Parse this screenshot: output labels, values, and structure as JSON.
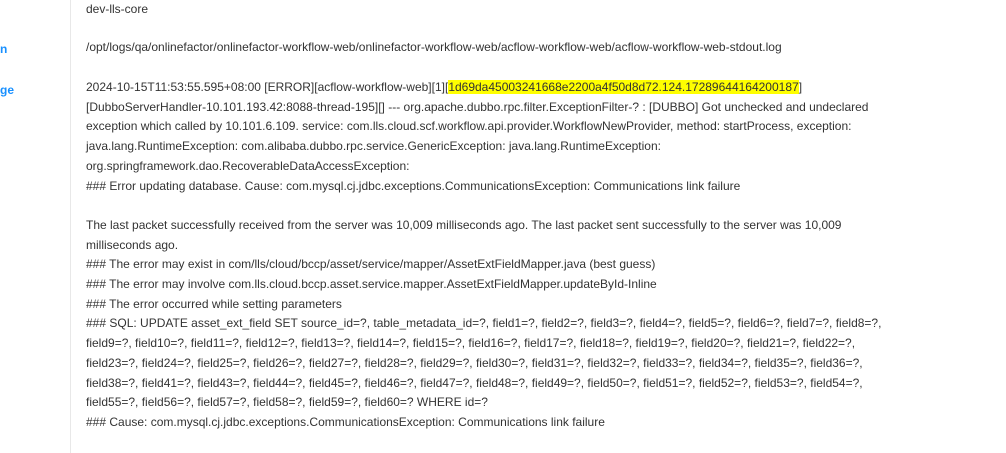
{
  "side_labels": {
    "label_1": "n",
    "label_2": "ge"
  },
  "project": "dev-lls-core",
  "log_path": "/opt/logs/qa/onlinefactor/onlinefactor-workflow-web/onlinefactor-workflow-web/acflow-workflow-web/acflow-workflow-web-stdout.log",
  "message": {
    "prefix": "2024-10-15T11:53:55.595+08:00 [ERROR][acflow-workflow-web][1][",
    "trace_id": "1d69da45003241668e2200a4f50d8d72.124.17289644164200187",
    "suffix": "]",
    "lines": [
      "[DubboServerHandler-10.101.193.42:8088-thread-195][] --- org.apache.dubbo.rpc.filter.ExceptionFilter-? :  [DUBBO] Got unchecked and undeclared",
      "exception which called by 10.101.6.109. service: com.lls.cloud.scf.workflow.api.provider.WorkflowNewProvider, method: startProcess, exception:",
      "java.lang.RuntimeException: com.alibaba.dubbo.rpc.service.GenericException: java.lang.RuntimeException:",
      "org.springframework.dao.RecoverableDataAccessException:",
      "### Error updating database.  Cause: com.mysql.cj.jdbc.exceptions.CommunicationsException: Communications link failure",
      "",
      "The last packet successfully received from the server was 10,009 milliseconds ago. The last packet sent successfully to the server was 10,009",
      "milliseconds ago.",
      "### The error may exist in com/lls/cloud/bccp/asset/service/mapper/AssetExtFieldMapper.java (best guess)",
      "### The error may involve com.lls.cloud.bccp.asset.service.mapper.AssetExtFieldMapper.updateById-Inline",
      "### The error occurred while setting parameters",
      "### SQL: UPDATE asset_ext_field  SET source_id=?, table_metadata_id=?, field1=?, field2=?, field3=?, field4=?, field5=?, field6=?, field7=?, field8=?,",
      "field9=?, field10=?, field11=?, field12=?, field13=?, field14=?, field15=?, field16=?, field17=?, field18=?, field19=?, field20=?, field21=?, field22=?,",
      "field23=?, field24=?, field25=?, field26=?, field27=?, field28=?, field29=?, field30=?, field31=?, field32=?, field33=?, field34=?, field35=?, field36=?,",
      "field38=?,   field41=?,  field43=?, field44=?, field45=?, field46=?, field47=?, field48=?, field49=?, field50=?, field51=?, field52=?, field53=?, field54=?,",
      "field55=?, field56=?, field57=?, field58=?, field59=?, field60=?  WHERE id=?",
      "### Cause: com.mysql.cj.jdbc.exceptions.CommunicationsException: Communications link failure"
    ]
  },
  "colors": {
    "label": "#1890ff",
    "highlight": "#ffff00",
    "text": "#333333"
  }
}
